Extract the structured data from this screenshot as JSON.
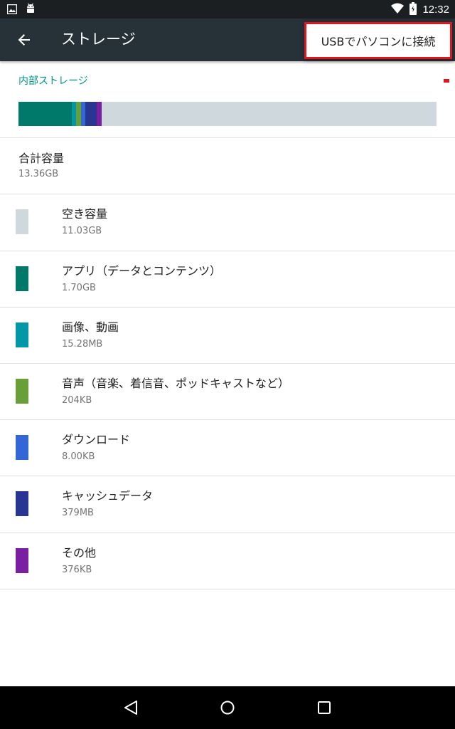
{
  "status_bar": {
    "time": "12:32",
    "icons": [
      "image-icon",
      "android-icon",
      "wifi-icon",
      "battery-icon"
    ]
  },
  "app_bar": {
    "title": "ストレージ",
    "back_icon": "arrow-back-icon"
  },
  "overflow_menu": {
    "item_label": "USBでパソコンに接続",
    "highlight_color": "#e0161e"
  },
  "storage": {
    "section_header": "内部ストレージ",
    "total_title": "合計容量",
    "total_value": "13.36GB",
    "bar_segments": [
      {
        "name": "apps",
        "fraction": 0.127,
        "color": "#00796b"
      },
      {
        "name": "images",
        "fraction": 0.011,
        "color": "#0097a7"
      },
      {
        "name": "audio",
        "fraction": 0.011,
        "color": "#689f38"
      },
      {
        "name": "downloads",
        "fraction": 0.011,
        "color": "#3367d6"
      },
      {
        "name": "cache",
        "fraction": 0.028,
        "color": "#283593"
      },
      {
        "name": "other",
        "fraction": 0.011,
        "color": "#7b1fa2"
      }
    ],
    "free_color": "#cfd8dc",
    "items": [
      {
        "label": "空き容量",
        "value": "11.03GB",
        "color": "#cfd8dc"
      },
      {
        "label": "アプリ（データとコンテンツ）",
        "value": "1.70GB",
        "color": "#00796b"
      },
      {
        "label": "画像、動画",
        "value": "15.28MB",
        "color": "#0097a7"
      },
      {
        "label": "音声（音楽、着信音、ポッドキャストなど）",
        "value": "204KB",
        "color": "#689f38"
      },
      {
        "label": "ダウンロード",
        "value": "8.00KB",
        "color": "#3367d6"
      },
      {
        "label": "キャッシュデータ",
        "value": "379MB",
        "color": "#283593"
      },
      {
        "label": "その他",
        "value": "376KB",
        "color": "#7b1fa2"
      }
    ]
  },
  "nav_bar": {
    "buttons": [
      "back-triangle-icon",
      "home-circle-icon",
      "recents-square-icon"
    ]
  }
}
